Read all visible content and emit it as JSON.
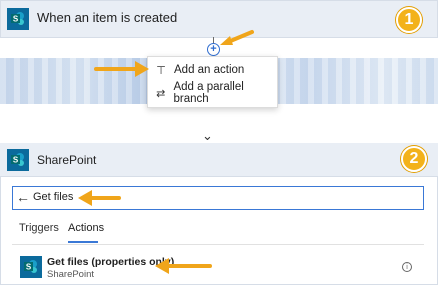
{
  "trigger": {
    "title": "When an item is created",
    "icon": "sharepoint-icon"
  },
  "connector": {
    "plus_symbol": "+"
  },
  "menu": {
    "items": [
      {
        "label": "Add an action",
        "icon": "add-action-icon",
        "glyph": "⊤"
      },
      {
        "label": "Add a parallel branch",
        "icon": "parallel-branch-icon",
        "glyph": "⇄"
      }
    ]
  },
  "flow": {
    "down_arrow": "⌄"
  },
  "action": {
    "title": "SharePoint",
    "icon": "sharepoint-icon",
    "search": {
      "value": "Get files",
      "back_glyph": "←"
    },
    "tabs": [
      {
        "label": "Triggers",
        "active": false
      },
      {
        "label": "Actions",
        "active": true
      }
    ],
    "result": {
      "title": "Get files (properties only)",
      "subtitle": "SharePoint",
      "info_glyph": "i"
    }
  },
  "badges": [
    "1",
    "2"
  ],
  "colors": {
    "accent": "#3a78d6",
    "sharepoint": "#0b6a9c",
    "callout": "#f3b21a",
    "header_bg": "#e9eef5"
  }
}
